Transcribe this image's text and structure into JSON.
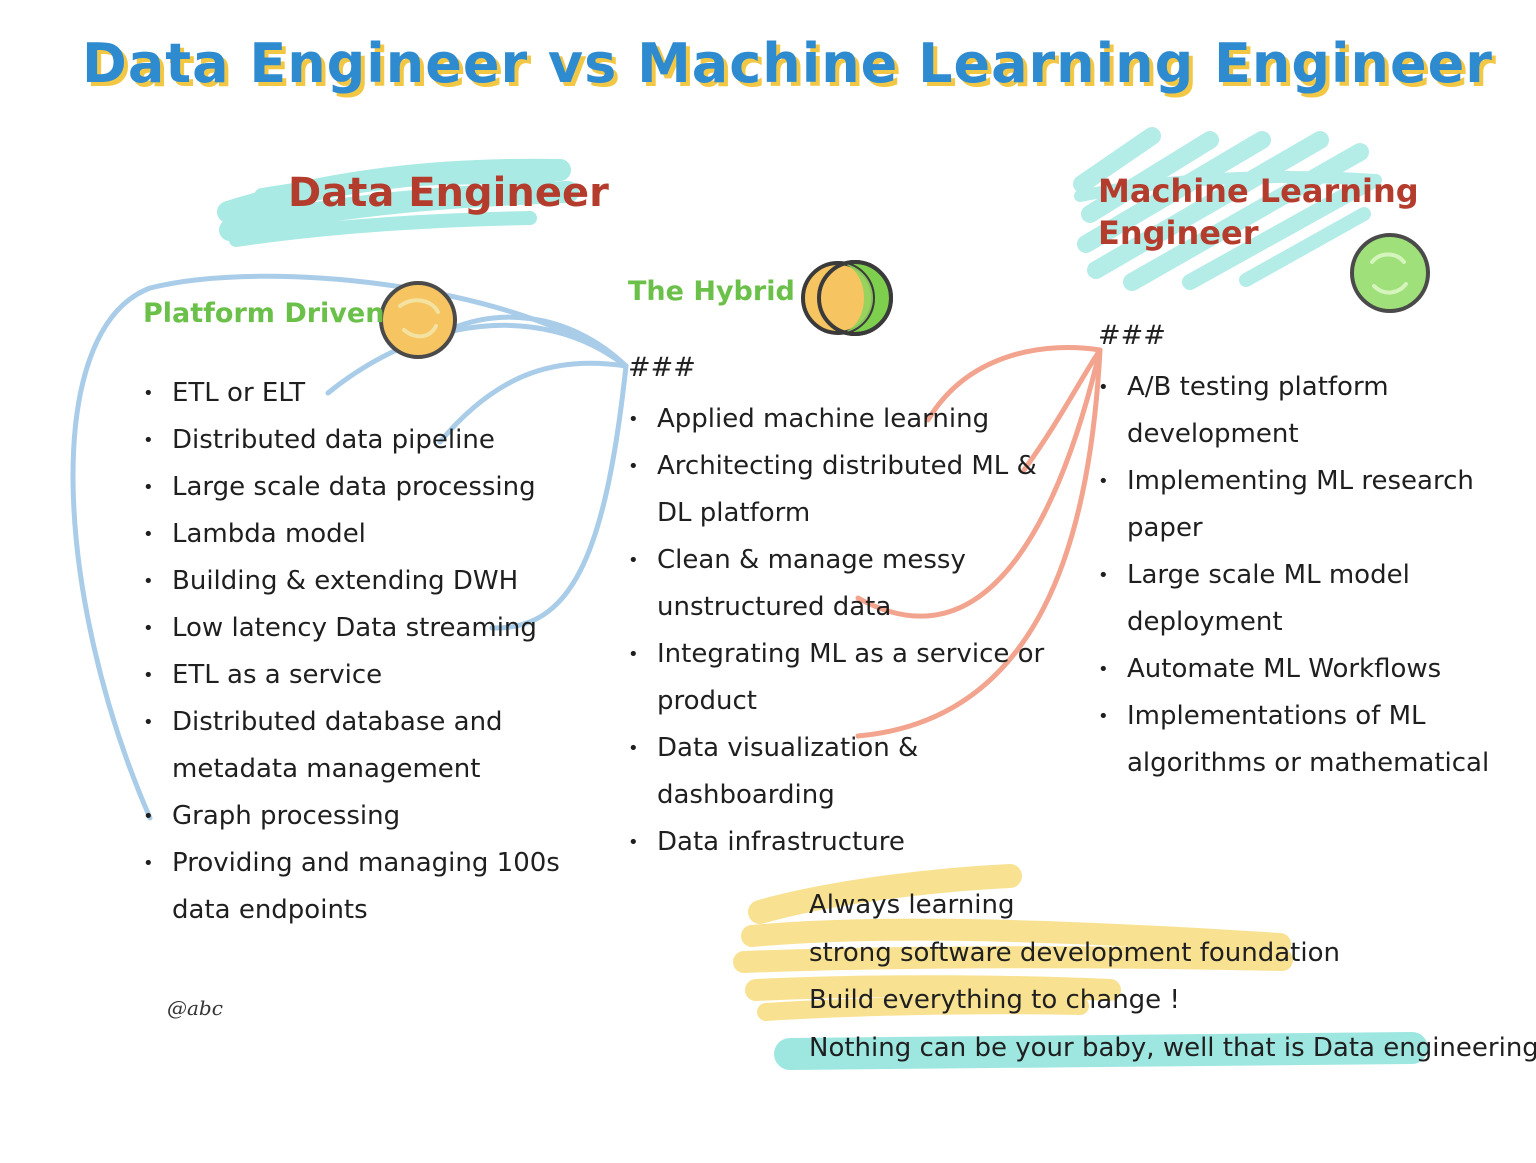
{
  "title": "Data Engineer vs Machine Learning Engineer",
  "colors": {
    "title": "#2f8bd0",
    "title_shadow": "#f2c744",
    "heading_red": "#b43c2c",
    "subheading_green": "#6bc04a",
    "cyan_highlight": "#8de3dc",
    "yellow_highlight": "#f7dd7e",
    "blue_connector": "#a9cce9",
    "salmon_connector": "#f2a48e",
    "text": "#1f1f1f"
  },
  "data_engineer": {
    "heading": "Data Engineer",
    "subheading": "Platform Driven",
    "icon": "orange-ball-icon",
    "items": [
      "ETL or ELT",
      "Distributed data pipeline",
      "Large scale data processing",
      "Lambda model",
      "Building & extending DWH",
      "Low latency Data streaming",
      "ETL as a service",
      "Distributed database and metadata management",
      "Graph processing",
      "Providing and managing 100s data endpoints"
    ]
  },
  "hybrid": {
    "heading": "The Hybrid",
    "marker": "###",
    "icon": "orange-and-green-balls-icon",
    "items": [
      "Applied machine learning",
      "Architecting distributed ML & DL platform",
      "Clean & manage messy unstructured data",
      "Integrating ML as a service or product",
      "Data visualization & dashboarding",
      "Data infrastructure"
    ]
  },
  "ml_engineer": {
    "heading_line1": "Machine Learning",
    "heading_line2": "Engineer",
    "marker": "###",
    "icon": "green-ball-icon",
    "items": [
      "A/B testing platform development",
      "Implementing ML research paper",
      "Large scale ML model deployment",
      "Automate ML Workflows",
      "Implementations of ML algorithms or mathematical"
    ]
  },
  "notes": [
    "Always learning",
    "strong software development foundation",
    "Build everything to change !",
    "Nothing can be your baby, well that is Data engineering"
  ],
  "signature": "@abc"
}
